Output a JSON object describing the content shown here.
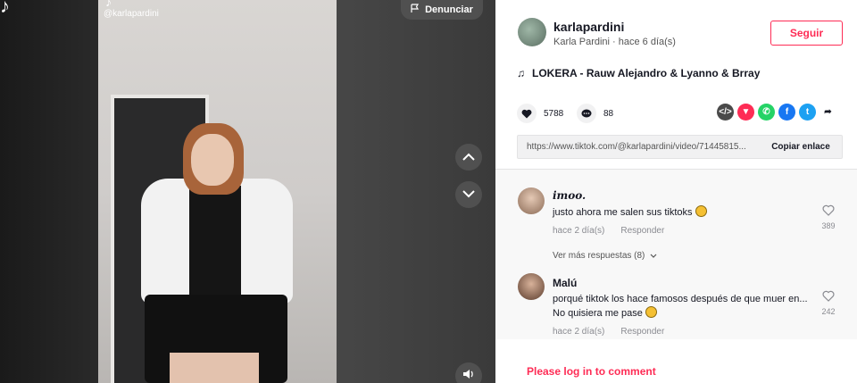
{
  "player": {
    "handle": "@karlapardini",
    "report_label": "Denunciar"
  },
  "author": {
    "username": "karlapardini",
    "display_meta": "Karla Pardini · hace 6 día(s)",
    "follow_label": "Seguir"
  },
  "music": {
    "title": "LOKERA - Rauw Alejandro & Lyanno & Brray"
  },
  "stats": {
    "likes": "5788",
    "comments": "88"
  },
  "share": {
    "icons": [
      "embed-icon",
      "tiktok-send-icon",
      "whatsapp-icon",
      "facebook-icon",
      "twitter-icon",
      "share-arrow-icon"
    ],
    "colors": {
      "embed": "#4a4a4a",
      "send": "#fe2c55",
      "whatsapp": "#25d366",
      "facebook": "#1877f2",
      "twitter": "#1da1f2"
    }
  },
  "link": {
    "url": "https://www.tiktok.com/@karlapardini/video/71445815...",
    "copy_label": "Copiar enlace"
  },
  "comments": [
    {
      "name": "imoo.",
      "text": "justo ahora me salen sus tiktoks",
      "time": "hace 2 día(s)",
      "reply": "Responder",
      "likes": "389"
    },
    {
      "name": "Malú",
      "text": "porqué tiktok los hace famosos después de que muer en... No quisiera me pase",
      "time": "hace 2 día(s)",
      "reply": "Responder",
      "likes": "242"
    }
  ],
  "more_replies": "Ver más respuestas (8)",
  "login_prompt": "Please log in to comment",
  "accent_color": "#fe2c55"
}
